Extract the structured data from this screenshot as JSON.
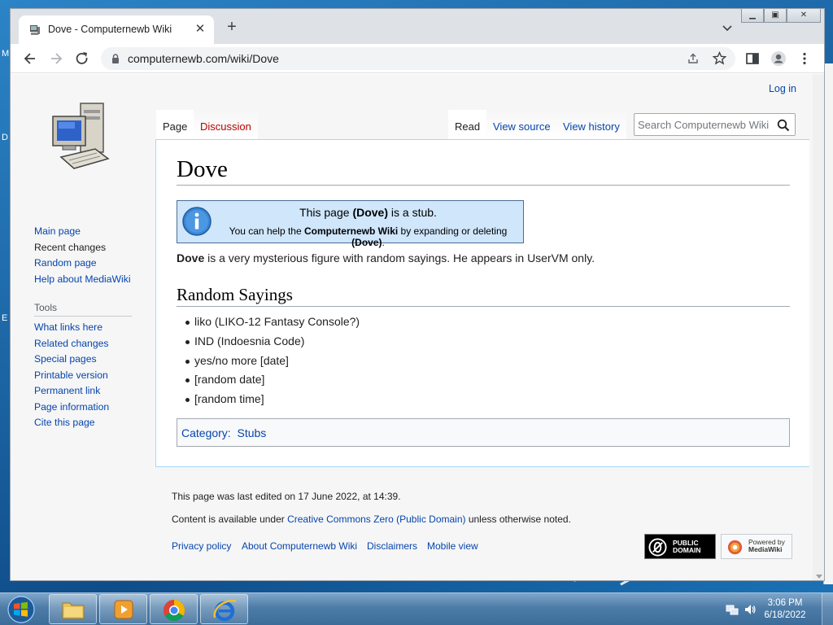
{
  "browser": {
    "tab_title": "Dove - Computernewb Wiki",
    "url": "computernewb.com/wiki/Dove"
  },
  "wiki": {
    "login": "Log in",
    "nav": [
      "Main page",
      "Recent changes",
      "Random page",
      "Help about MediaWiki"
    ],
    "tools_heading": "Tools",
    "tools": [
      "What links here",
      "Related changes",
      "Special pages",
      "Printable version",
      "Permanent link",
      "Page information",
      "Cite this page"
    ],
    "tabs": {
      "page": "Page",
      "discussion": "Discussion",
      "read": "Read",
      "view_source": "View source",
      "view_history": "View history"
    },
    "search_placeholder": "Search Computernewb Wiki",
    "title": "Dove",
    "stub": {
      "l1_pre": "This page ",
      "l1_bold": "(Dove)",
      "l1_post": " is a stub.",
      "l2_pre": "You can help the ",
      "l2_bold1": "Computernewb Wiki",
      "l2_mid": " by expanding or deleting ",
      "l2_bold2": "(Dove)",
      "l2_post": "."
    },
    "intro_bold": "Dove",
    "intro_rest": " is a very mysterious figure with random sayings. He appears in UserVM only.",
    "section_heading": "Random Sayings",
    "sayings": [
      "liko (LIKO-12 Fantasy Console?)",
      "IND (Indoesnia Code)",
      "yes/no more [date]",
      "[random date]",
      "[random time]"
    ],
    "category_label": "Category:",
    "category": "Stubs",
    "footer": {
      "last_edited": "This page was last edited on 17 June 2022, at 14:39.",
      "content_pre": "Content is available under ",
      "license": "Creative Commons Zero (Public Domain)",
      "content_post": " unless otherwise noted.",
      "links": [
        "Privacy policy",
        "About Computernewb Wiki",
        "Disclaimers",
        "Mobile view"
      ],
      "badge_pd": [
        "PUBLIC",
        "DOMAIN"
      ],
      "badge_mw": [
        "Powered by",
        "MediaWiki"
      ]
    }
  },
  "taskbar": {
    "time": "3:06 PM",
    "date": "6/18/2022"
  },
  "colors": {
    "link": "#0645ad",
    "stub_bg": "#cfe6fb",
    "content_border": "#a7d7f9"
  }
}
